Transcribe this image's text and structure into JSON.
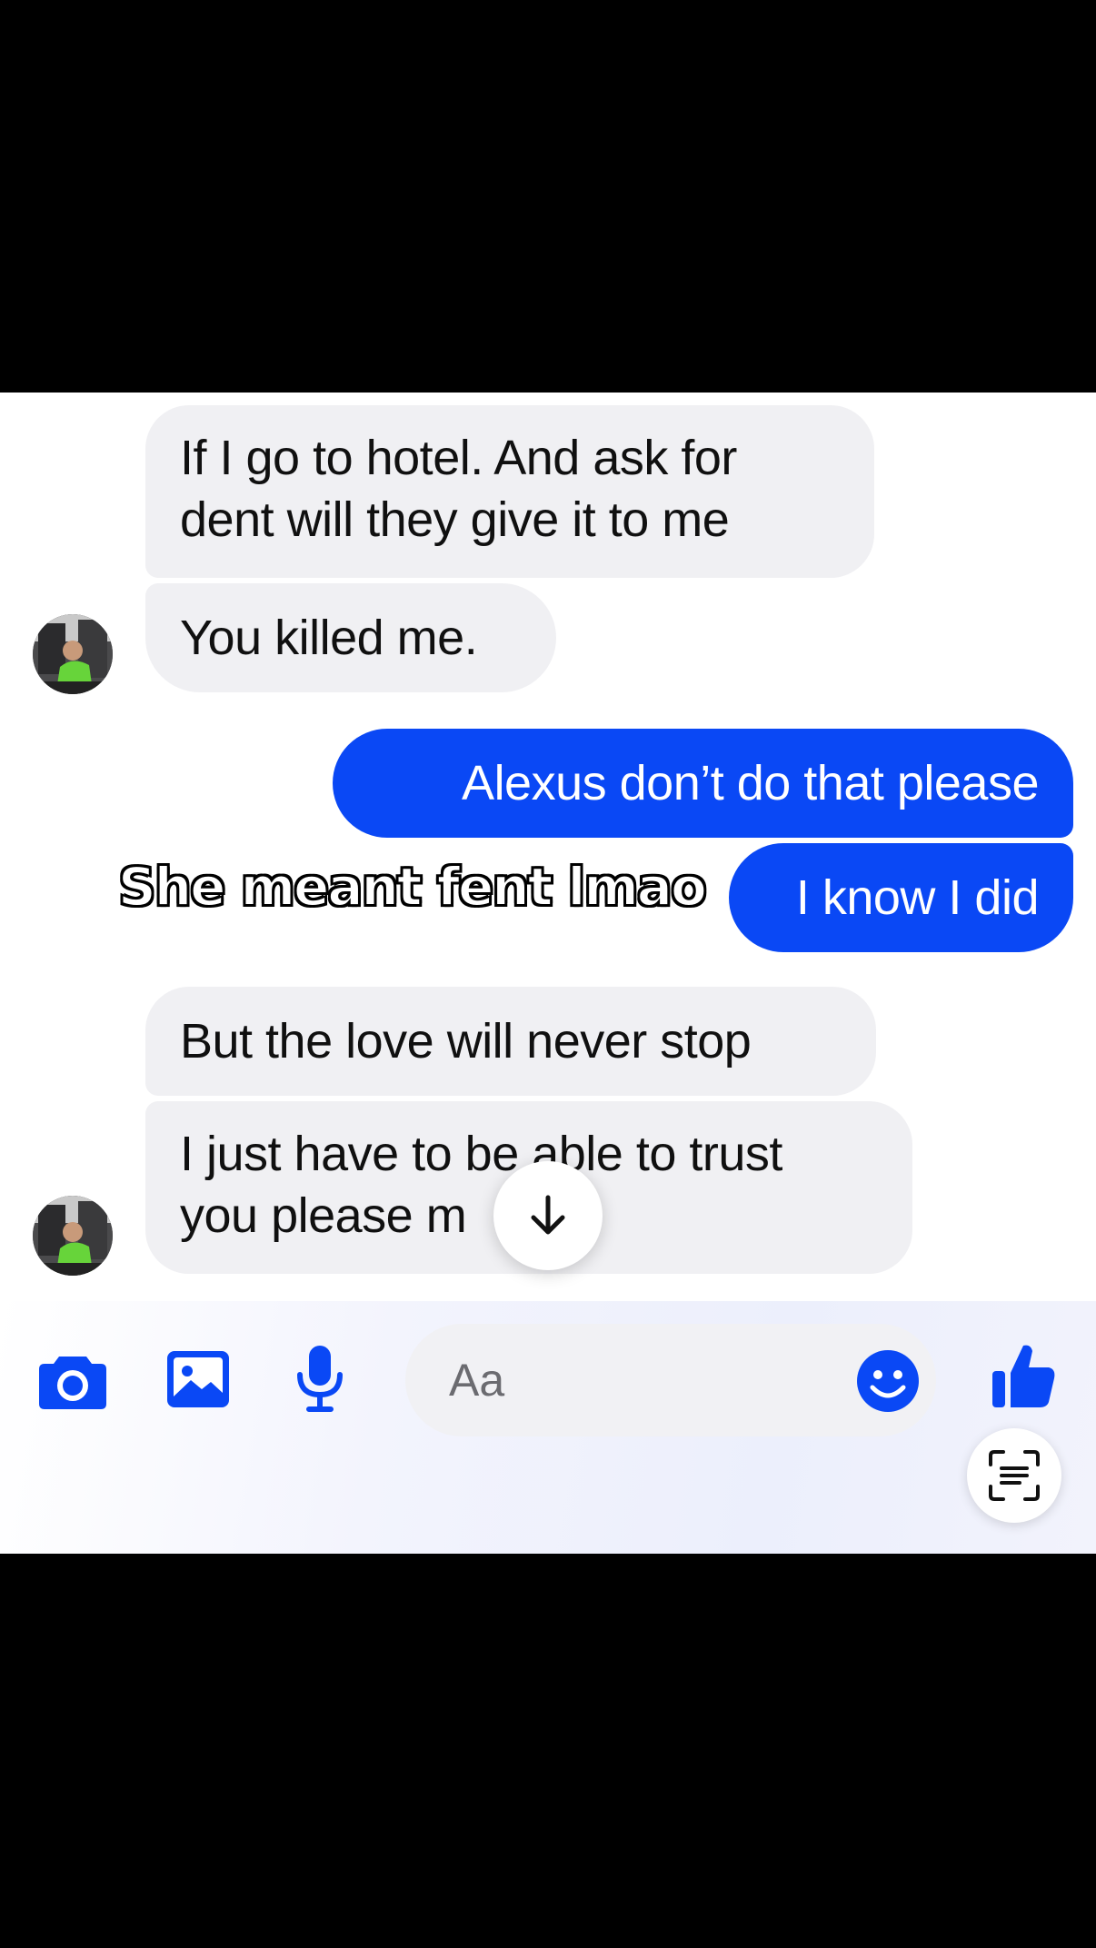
{
  "conversation": {
    "messages": [
      {
        "side": "incoming",
        "text_lines": [
          "If I go to hotel. And ask for",
          "dent will they give it to me"
        ]
      },
      {
        "side": "incoming",
        "text_lines": [
          "You killed me."
        ]
      },
      {
        "side": "outgoing",
        "text_lines": [
          "Alexus don’t do that please"
        ]
      },
      {
        "side": "outgoing",
        "text_lines": [
          "I know I did"
        ]
      },
      {
        "side": "incoming",
        "text_lines": [
          "But the love will never stop"
        ]
      },
      {
        "side": "incoming",
        "text_lines": [
          "I just have to be able to trust",
          "you please m"
        ]
      }
    ],
    "caption_overlay": "She meant fent lmao"
  },
  "composer": {
    "placeholder": "Aa",
    "icons": [
      "camera-icon",
      "gallery-icon",
      "microphone-icon",
      "emoji-icon",
      "thumbs-up-icon",
      "scan-text-icon"
    ]
  },
  "colors": {
    "accent": "#0a48f5",
    "incoming_bubble": "#f0f0f3",
    "background": "#ffffff",
    "letterbox": "#000000"
  }
}
